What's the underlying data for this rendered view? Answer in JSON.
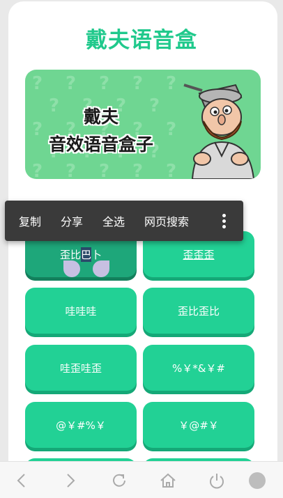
{
  "app": {
    "title": "戴夫语音盒"
  },
  "banner": {
    "line1": "戴夫",
    "line2": "音效语音盒子"
  },
  "buttons": [
    {
      "label_a": "歪比",
      "label_b": "巴",
      "label_c": "卜"
    },
    {
      "label": "歪歪歪"
    },
    {
      "label": "哇哇哇"
    },
    {
      "label": "歪比歪比"
    },
    {
      "label": "哇歪哇歪"
    },
    {
      "label": "%￥*&￥#"
    },
    {
      "label": "@￥#%￥"
    },
    {
      "label": "￥@#￥"
    }
  ],
  "context_menu": {
    "copy": "复制",
    "share": "分享",
    "select_all": "全选",
    "web_search": "网页搜索"
  },
  "nav": [
    "back-icon",
    "forward-icon",
    "refresh-icon",
    "home-icon",
    "power-icon",
    "menu-icon"
  ],
  "colors": {
    "accent": "#22d195",
    "title": "#20c98c",
    "banner": "#6fd692",
    "menu_bg": "#3a3a3a"
  }
}
